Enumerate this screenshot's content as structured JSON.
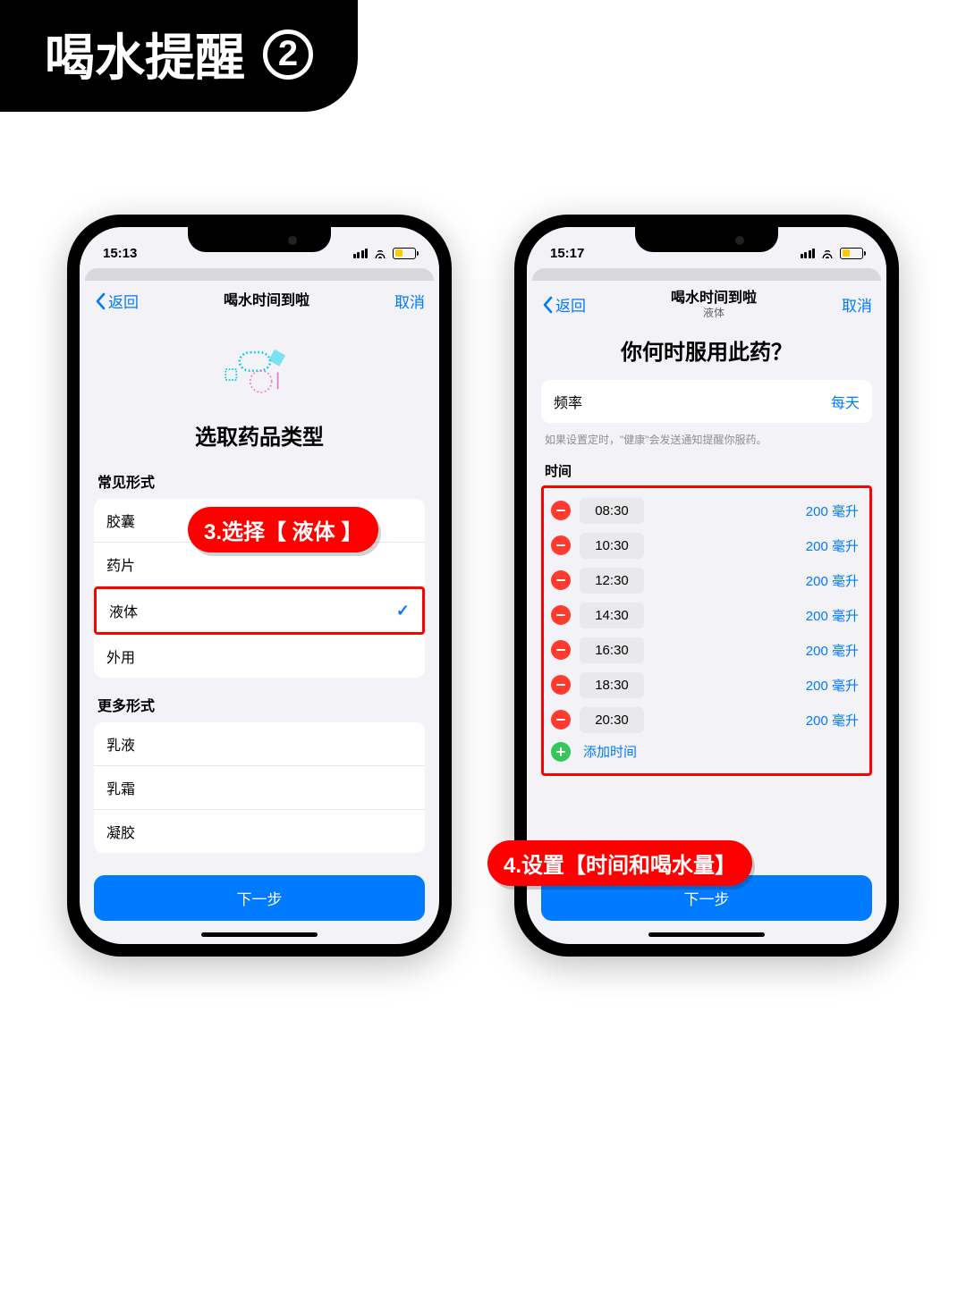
{
  "banner": {
    "title": "喝水提醒",
    "number": "2"
  },
  "callouts": {
    "c1_prefix": "3.选择",
    "c1_em": "【 液体 】",
    "c2_prefix": "4.设置",
    "c2_em": "【时间和喝水量】"
  },
  "phone1": {
    "status_time": "15:13",
    "nav_back": "返回",
    "nav_title": "喝水时间到啦",
    "nav_cancel": "取消",
    "page_title": "选取药品类型",
    "section1_label": "常见形式",
    "section1_items": [
      "胶囊",
      "药片",
      "液体",
      "外用"
    ],
    "selected_index": 2,
    "section2_label": "更多形式",
    "section2_items": [
      "乳液",
      "乳霜",
      "凝胶"
    ],
    "next_btn": "下一步"
  },
  "phone2": {
    "status_time": "15:17",
    "nav_back": "返回",
    "nav_title": "喝水时间到啦",
    "nav_subtitle": "液体",
    "nav_cancel": "取消",
    "page_title": "你何时服用此药？",
    "freq_label": "频率",
    "freq_value": "每天",
    "hint": "如果设置定时，\"健康\"会发送通知提醒你服药。",
    "time_label": "时间",
    "times": [
      {
        "t": "08:30",
        "d": "200 毫升"
      },
      {
        "t": "10:30",
        "d": "200 毫升"
      },
      {
        "t": "12:30",
        "d": "200 毫升"
      },
      {
        "t": "14:30",
        "d": "200 毫升"
      },
      {
        "t": "16:30",
        "d": "200 毫升"
      },
      {
        "t": "18:30",
        "d": "200 毫升"
      },
      {
        "t": "20:30",
        "d": "200 毫升"
      }
    ],
    "add_time": "添加时间",
    "next_btn": "下一步"
  }
}
